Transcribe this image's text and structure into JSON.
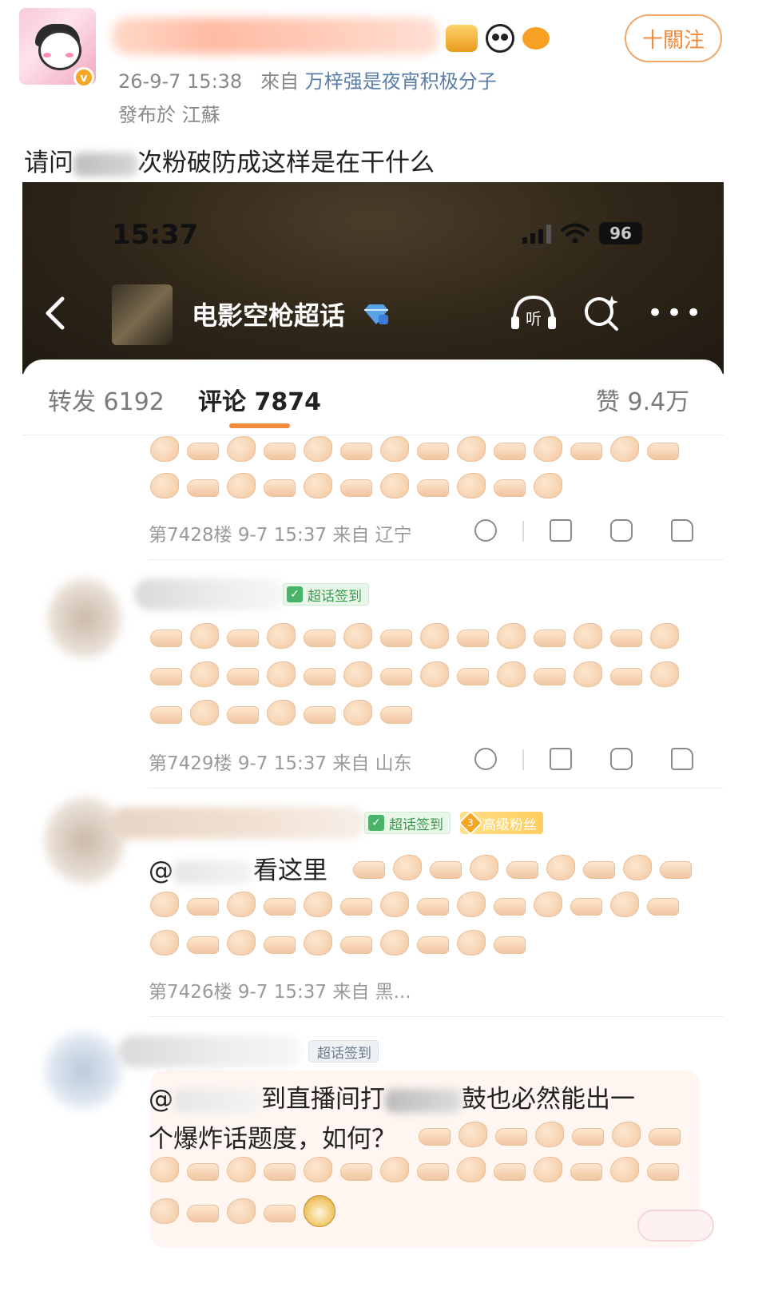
{
  "post": {
    "author_avatar": "anime-girl-avatar",
    "verified_badge": "v",
    "badges": [
      "crown-badge",
      "panda-badge",
      "pufferfish-badge"
    ],
    "follow_label": "十關注",
    "time": "26-9-7 15:38",
    "source_prefix": "來自",
    "source": "万梓强是夜宵积极分子",
    "location": "發布於 江蘇",
    "text_part1": "请问",
    "text_part2": "次粉破防成这样是在干什么"
  },
  "screenshot": {
    "status_bar": {
      "time": "15:37",
      "battery": "96"
    },
    "nav": {
      "back_icon": "chevron-left",
      "title": "电影空枪超话",
      "listen_label": "听",
      "more_icon": "more-dots"
    },
    "tabs": {
      "repost": "转发 6192",
      "comment": "评论 7874",
      "like": "赞 9.4万"
    },
    "comments": [
      {
        "floor_meta": "第7428楼  9-7 15:37  来自 辽宁"
      },
      {
        "tags": [
          "超话签到"
        ],
        "floor_meta": "第7429楼  9-7 15:37  来自 山东"
      },
      {
        "tags": [
          "超话签到",
          "高级粉丝"
        ],
        "fan_level": "3",
        "text": "@",
        "text_tail": "看这里",
        "floor_meta": "第7426楼  9-7 15:37  来自 黑..."
      },
      {
        "tags": [
          "超话签到"
        ],
        "text_head": "@",
        "text_line1": "到直播间打",
        "text_line1_tail": "鼓也必然能出一",
        "text_line2": "个爆炸话题度，如何？"
      }
    ],
    "accent_color": "#f08a3c"
  }
}
